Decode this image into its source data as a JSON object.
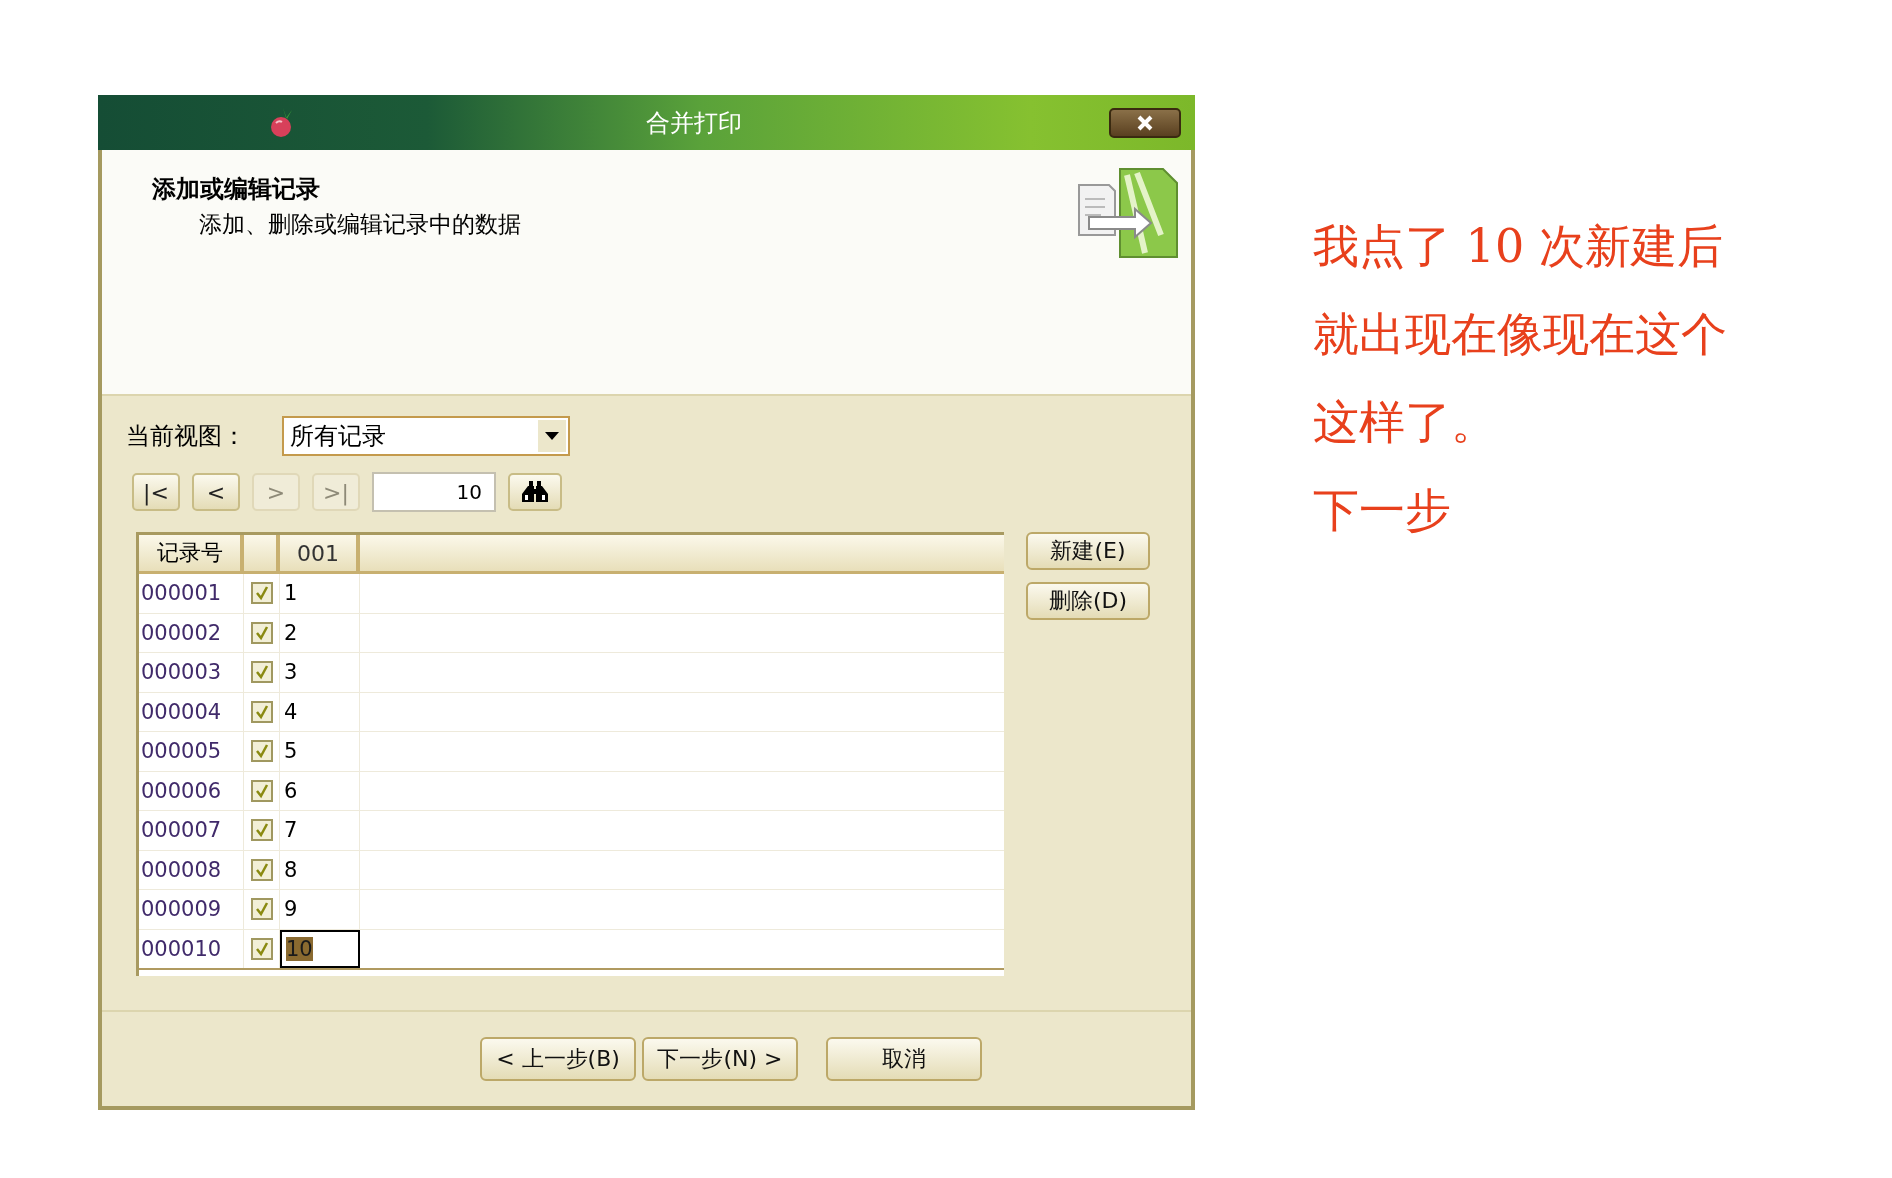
{
  "window": {
    "title": "合并打印"
  },
  "header": {
    "title": "添加或编辑记录",
    "subtitle": "添加、删除或编辑记录中的数据"
  },
  "view": {
    "label": "当前视图：",
    "value": "所有记录"
  },
  "nav_buttons": [
    {
      "label": "|<",
      "disabled": false
    },
    {
      "label": "<",
      "disabled": false
    },
    {
      "label": ">",
      "disabled": true
    },
    {
      "label": ">|",
      "disabled": true
    }
  ],
  "record_field": {
    "value": "10"
  },
  "table": {
    "columns": [
      "记录号",
      "001"
    ],
    "rows": [
      {
        "id": "000001",
        "checked": true,
        "value": "1",
        "selected": false
      },
      {
        "id": "000002",
        "checked": true,
        "value": "2",
        "selected": false
      },
      {
        "id": "000003",
        "checked": true,
        "value": "3",
        "selected": false
      },
      {
        "id": "000004",
        "checked": true,
        "value": "4",
        "selected": false
      },
      {
        "id": "000005",
        "checked": true,
        "value": "5",
        "selected": false
      },
      {
        "id": "000006",
        "checked": true,
        "value": "6",
        "selected": false
      },
      {
        "id": "000007",
        "checked": true,
        "value": "7",
        "selected": false
      },
      {
        "id": "000008",
        "checked": true,
        "value": "8",
        "selected": false
      },
      {
        "id": "000009",
        "checked": true,
        "value": "9",
        "selected": false
      },
      {
        "id": "000010",
        "checked": true,
        "value": "10",
        "selected": true
      }
    ]
  },
  "side_buttons": [
    "新建(E)",
    "删除(D)"
  ],
  "footer_buttons": [
    "< 上一步(B)",
    "下一步(N) >",
    "取消"
  ],
  "annotation": [
    "我点了 10 次新建后",
    "就出现在像现在这个",
    "这样了。",
    "下一步"
  ]
}
